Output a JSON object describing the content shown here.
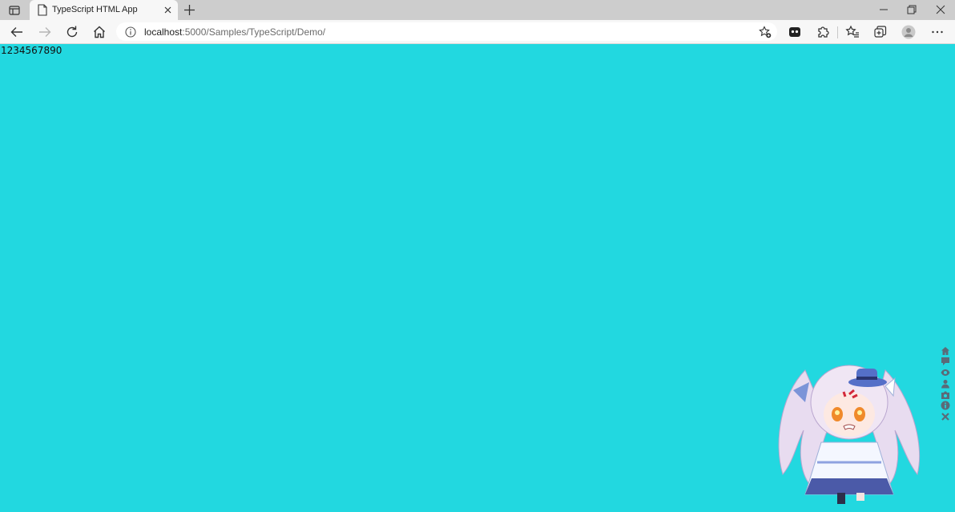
{
  "browser": {
    "tab": {
      "title": "TypeScript HTML App"
    },
    "address": {
      "host": "localhost",
      "rest": ":5000/Samples/TypeScript/Demo/"
    }
  },
  "page": {
    "counter_text": "1234567890",
    "background_color": "#22d8e0"
  },
  "widget": {
    "tools": [
      "home-icon",
      "chat-icon",
      "eye-icon",
      "person-icon",
      "camera-icon",
      "info-icon",
      "close-icon"
    ],
    "mascot": "chibi-character"
  }
}
